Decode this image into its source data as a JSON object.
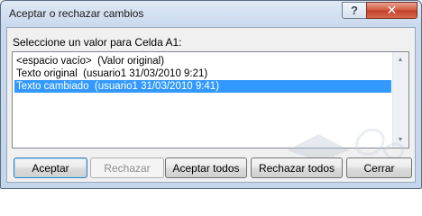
{
  "window": {
    "title": "Aceptar o rechazar cambios",
    "help_glyph": "?",
    "close_glyph": "✕"
  },
  "prompt": "Seleccione un valor para Celda A1:",
  "list": {
    "items": [
      {
        "text": "<espacio vacío>  (Valor original)",
        "selected": false
      },
      {
        "text": "Texto original  (usuario1 31/03/2010 9:21)",
        "selected": false
      },
      {
        "text": "Texto cambiado  (usuario1 31/03/2010 9:41)",
        "selected": true
      }
    ]
  },
  "buttons": {
    "accept": "Aceptar",
    "reject": "Rechazar",
    "accept_all": "Aceptar todos",
    "reject_all": "Rechazar todos",
    "close": "Cerrar"
  },
  "colors": {
    "selection": "#3399ff",
    "close_button": "#c4402a"
  }
}
